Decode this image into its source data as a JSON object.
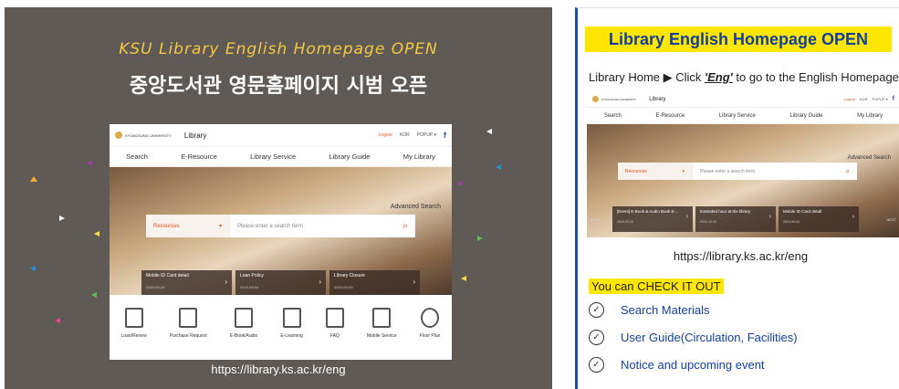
{
  "left": {
    "title_en": "KSU Library English Homepage OPEN",
    "title_ko": "중앙도서관 영문홈페이지 시범 오픈",
    "url": "https://library.ks.ac.kr/eng"
  },
  "site": {
    "univ": "KYUNGSUNG UNIVERSITY",
    "library": "Library",
    "logout": "Logout",
    "kor": "KOR",
    "popup": "POPUP ▾",
    "fb": "f",
    "nav": [
      "Search",
      "E-Resource",
      "Library Service",
      "Library Guide",
      "My Library"
    ],
    "advanced": "Advanced Search",
    "select": "Resources",
    "placeholder": "Please enter a search term",
    "cards_left": [
      {
        "title": "Mobile ID Card detail",
        "date": "2019-09-04"
      },
      {
        "title": "Loan Policy",
        "date": "2019-09-04"
      },
      {
        "title": "Library Closure",
        "date": "2019-09-03"
      }
    ],
    "cards_right": [
      {
        "title": "[Event] E-Book & Audio Book E-...",
        "date": "2019-10-10"
      },
      {
        "title": "Extended hour at the library",
        "date": "2019-10-10"
      },
      {
        "title": "Mobile ID Card detail",
        "date": "2019-09-04"
      }
    ],
    "prev": "PREV",
    "next": "NEXT",
    "services": [
      "Loan/Renew",
      "Purchase Request",
      "E-Book/Audio",
      "E-Learning",
      "FAQ",
      "Mobile Service",
      "Floor Plan"
    ]
  },
  "right": {
    "banner": "Library English Homepage OPEN",
    "instr_a": "Library Home ▶ Click ",
    "instr_b": "'Eng'",
    "instr_c": " to go to the English Homepage",
    "url": "https://library.ks.ac.kr/eng",
    "check": "You can CHECK IT OUT",
    "features": [
      "Search Materials",
      "User Guide(Circulation, Facilities)",
      "Notice and upcoming event"
    ]
  }
}
